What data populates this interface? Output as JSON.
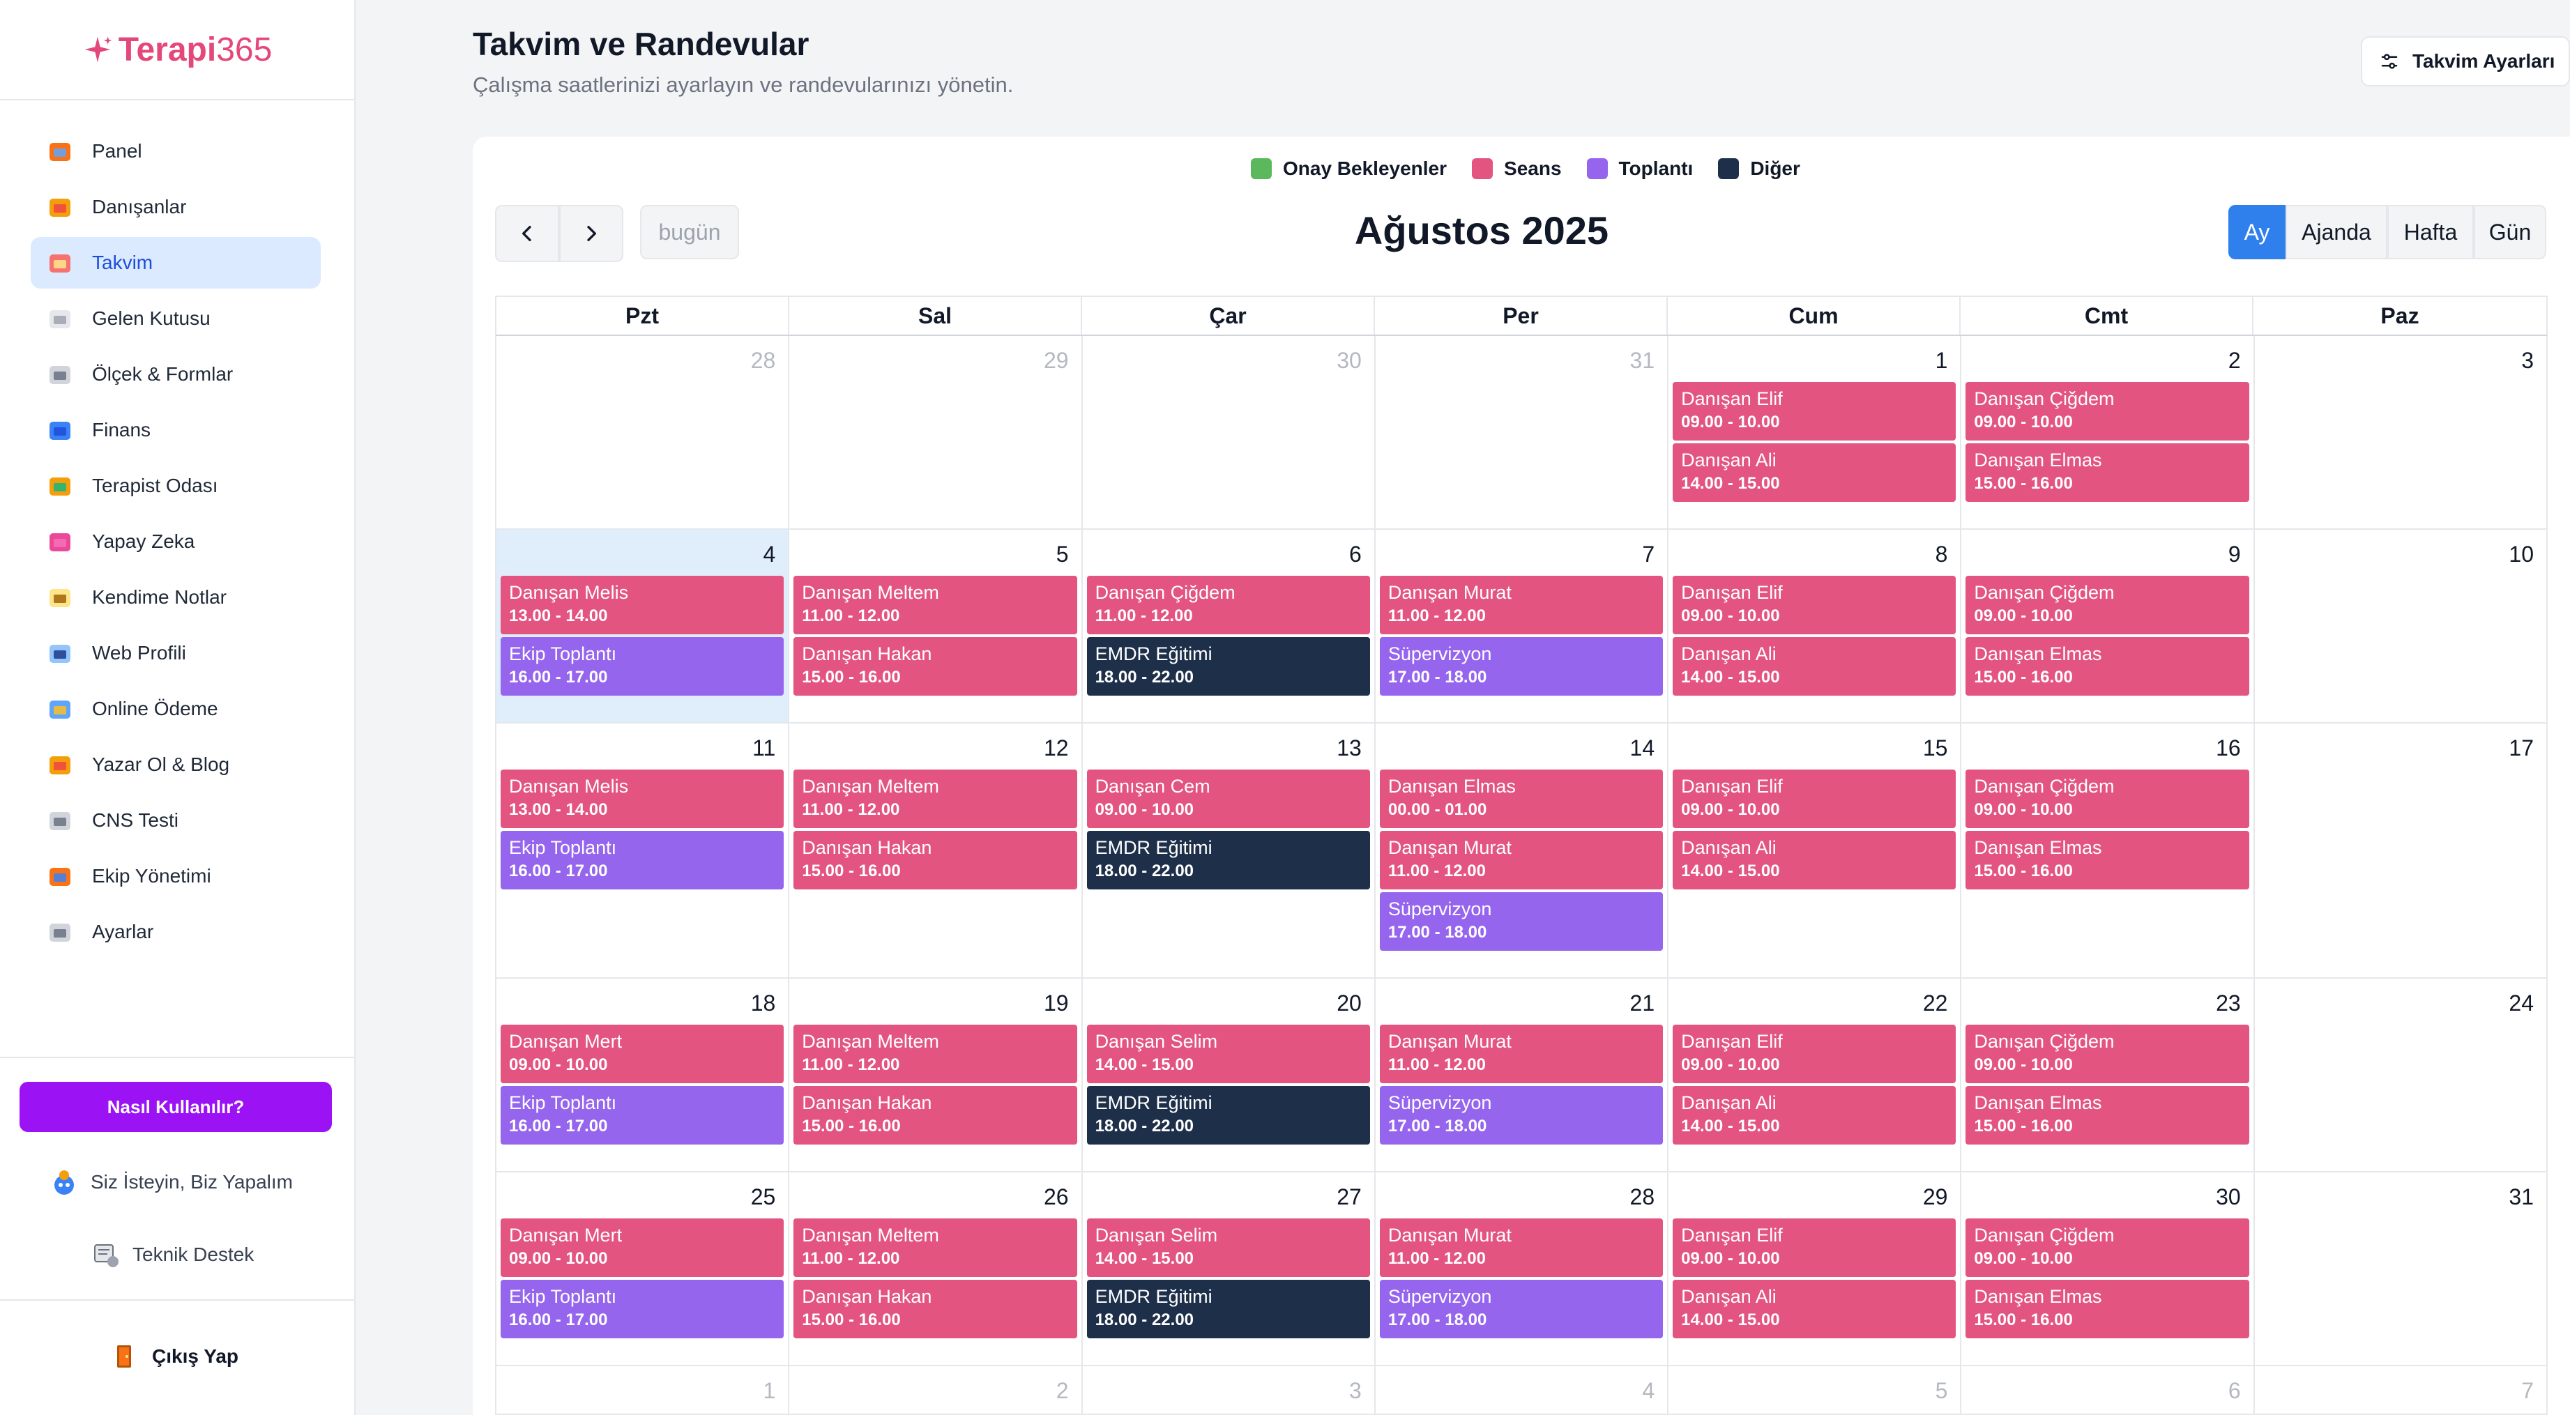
{
  "brand": {
    "name_bold": "Terapi",
    "name_light": "365",
    "color": "#e4477a"
  },
  "sidebar": {
    "items": [
      {
        "label": "Panel",
        "icon": "house-icon",
        "active": false
      },
      {
        "label": "Danışanlar",
        "icon": "people-icon",
        "active": false
      },
      {
        "label": "Takvim",
        "icon": "calendar-icon",
        "active": true
      },
      {
        "label": "Gelen Kutusu",
        "icon": "envelope-icon",
        "active": false
      },
      {
        "label": "Ölçek & Formlar",
        "icon": "forms-icon",
        "active": false
      },
      {
        "label": "Finans",
        "icon": "finance-icon",
        "active": false
      },
      {
        "label": "Terapist Odası",
        "icon": "therapist-room-icon",
        "active": false
      },
      {
        "label": "Yapay Zeka",
        "icon": "sparkle-icon",
        "active": false
      },
      {
        "label": "Kendime Notlar",
        "icon": "notes-icon",
        "active": false
      },
      {
        "label": "Web Profili",
        "icon": "web-profile-icon",
        "active": false
      },
      {
        "label": "Online Ödeme",
        "icon": "payment-icon",
        "active": false
      },
      {
        "label": "Yazar Ol & Blog",
        "icon": "writer-icon",
        "active": false
      },
      {
        "label": "CNS Testi",
        "icon": "brain-icon",
        "active": false
      },
      {
        "label": "Ekip Yönetimi",
        "icon": "team-icon",
        "active": false
      },
      {
        "label": "Ayarlar",
        "icon": "gear-icon",
        "active": false
      }
    ],
    "help_button": "Nasıl Kullanılır?",
    "request_link": "Siz İsteyin, Biz Yapalım",
    "support_link": "Teknik Destek",
    "logout": "Çıkış Yap"
  },
  "header": {
    "title": "Takvim ve Randevular",
    "subtitle": "Çalışma saatlerinizi ayarlayın ve randevularınızı yönetin.",
    "settings_button": "Takvim Ayarları"
  },
  "legend": [
    {
      "label": "Onay Bekleyenler",
      "color": "#5cb85c"
    },
    {
      "label": "Seans",
      "color": "#e35480"
    },
    {
      "label": "Toplantı",
      "color": "#9565ee"
    },
    {
      "label": "Diğer",
      "color": "#1e2f4a"
    }
  ],
  "toolbar": {
    "prev_icon": "chevron-left-icon",
    "next_icon": "chevron-right-icon",
    "today": "bugün",
    "month_title": "Ağustos 2025",
    "views": [
      {
        "label": "Ay",
        "active": true
      },
      {
        "label": "Ajanda",
        "active": false
      },
      {
        "label": "Hafta",
        "active": false
      },
      {
        "label": "Gün",
        "active": false
      }
    ]
  },
  "calendar": {
    "weekdays": [
      "Pzt",
      "Sal",
      "Çar",
      "Per",
      "Cum",
      "Cmt",
      "Paz"
    ],
    "weeks": [
      {
        "days": [
          {
            "num": "28",
            "out": true,
            "events": []
          },
          {
            "num": "29",
            "out": true,
            "events": []
          },
          {
            "num": "30",
            "out": true,
            "events": []
          },
          {
            "num": "31",
            "out": true,
            "events": []
          },
          {
            "num": "1",
            "events": [
              {
                "title": "Danışan Elif",
                "time": "09.00 - 10.00",
                "type": "seans"
              },
              {
                "title": "Danışan Ali",
                "time": "14.00 - 15.00",
                "type": "seans"
              }
            ]
          },
          {
            "num": "2",
            "events": [
              {
                "title": "Danışan Çiğdem",
                "time": "09.00 - 10.00",
                "type": "seans"
              },
              {
                "title": "Danışan Elmas",
                "time": "15.00 - 16.00",
                "type": "seans"
              }
            ]
          },
          {
            "num": "3",
            "events": []
          }
        ]
      },
      {
        "days": [
          {
            "num": "4",
            "today": true,
            "events": [
              {
                "title": "Danışan Melis",
                "time": "13.00 - 14.00",
                "type": "seans"
              },
              {
                "title": "Ekip Toplantı",
                "time": "16.00 - 17.00",
                "type": "toplanti"
              }
            ]
          },
          {
            "num": "5",
            "events": [
              {
                "title": "Danışan Meltem",
                "time": "11.00 - 12.00",
                "type": "seans"
              },
              {
                "title": "Danışan Hakan",
                "time": "15.00 - 16.00",
                "type": "seans"
              }
            ]
          },
          {
            "num": "6",
            "events": [
              {
                "title": "Danışan Çiğdem",
                "time": "11.00 - 12.00",
                "type": "seans"
              },
              {
                "title": "EMDR Eğitimi",
                "time": "18.00 - 22.00",
                "type": "diger"
              }
            ]
          },
          {
            "num": "7",
            "events": [
              {
                "title": "Danışan Murat",
                "time": "11.00 - 12.00",
                "type": "seans"
              },
              {
                "title": "Süpervizyon",
                "time": "17.00 - 18.00",
                "type": "toplanti"
              }
            ]
          },
          {
            "num": "8",
            "events": [
              {
                "title": "Danışan Elif",
                "time": "09.00 - 10.00",
                "type": "seans"
              },
              {
                "title": "Danışan Ali",
                "time": "14.00 - 15.00",
                "type": "seans"
              }
            ]
          },
          {
            "num": "9",
            "events": [
              {
                "title": "Danışan Çiğdem",
                "time": "09.00 - 10.00",
                "type": "seans"
              },
              {
                "title": "Danışan Elmas",
                "time": "15.00 - 16.00",
                "type": "seans"
              }
            ]
          },
          {
            "num": "10",
            "events": []
          }
        ]
      },
      {
        "days": [
          {
            "num": "11",
            "events": [
              {
                "title": "Danışan Melis",
                "time": "13.00 - 14.00",
                "type": "seans"
              },
              {
                "title": "Ekip Toplantı",
                "time": "16.00 - 17.00",
                "type": "toplanti"
              }
            ]
          },
          {
            "num": "12",
            "events": [
              {
                "title": "Danışan Meltem",
                "time": "11.00 - 12.00",
                "type": "seans"
              },
              {
                "title": "Danışan Hakan",
                "time": "15.00 - 16.00",
                "type": "seans"
              }
            ]
          },
          {
            "num": "13",
            "events": [
              {
                "title": "Danışan Cem",
                "time": "09.00 - 10.00",
                "type": "seans"
              },
              {
                "title": "EMDR Eğitimi",
                "time": "18.00 - 22.00",
                "type": "diger"
              }
            ]
          },
          {
            "num": "14",
            "events": [
              {
                "title": "Danışan Elmas",
                "time": "00.00 - 01.00",
                "type": "seans"
              },
              {
                "title": "Danışan Murat",
                "time": "11.00 - 12.00",
                "type": "seans"
              },
              {
                "title": "Süpervizyon",
                "time": "17.00 - 18.00",
                "type": "toplanti"
              }
            ]
          },
          {
            "num": "15",
            "events": [
              {
                "title": "Danışan Elif",
                "time": "09.00 - 10.00",
                "type": "seans"
              },
              {
                "title": "Danışan Ali",
                "time": "14.00 - 15.00",
                "type": "seans"
              }
            ]
          },
          {
            "num": "16",
            "events": [
              {
                "title": "Danışan Çiğdem",
                "time": "09.00 - 10.00",
                "type": "seans"
              },
              {
                "title": "Danışan Elmas",
                "time": "15.00 - 16.00",
                "type": "seans"
              }
            ]
          },
          {
            "num": "17",
            "events": []
          }
        ]
      },
      {
        "days": [
          {
            "num": "18",
            "events": [
              {
                "title": "Danışan Mert",
                "time": "09.00 - 10.00",
                "type": "seans"
              },
              {
                "title": "Ekip Toplantı",
                "time": "16.00 - 17.00",
                "type": "toplanti"
              }
            ]
          },
          {
            "num": "19",
            "events": [
              {
                "title": "Danışan Meltem",
                "time": "11.00 - 12.00",
                "type": "seans"
              },
              {
                "title": "Danışan Hakan",
                "time": "15.00 - 16.00",
                "type": "seans"
              }
            ]
          },
          {
            "num": "20",
            "events": [
              {
                "title": "Danışan Selim",
                "time": "14.00 - 15.00",
                "type": "seans"
              },
              {
                "title": "EMDR Eğitimi",
                "time": "18.00 - 22.00",
                "type": "diger"
              }
            ]
          },
          {
            "num": "21",
            "events": [
              {
                "title": "Danışan Murat",
                "time": "11.00 - 12.00",
                "type": "seans"
              },
              {
                "title": "Süpervizyon",
                "time": "17.00 - 18.00",
                "type": "toplanti"
              }
            ]
          },
          {
            "num": "22",
            "events": [
              {
                "title": "Danışan Elif",
                "time": "09.00 - 10.00",
                "type": "seans"
              },
              {
                "title": "Danışan Ali",
                "time": "14.00 - 15.00",
                "type": "seans"
              }
            ]
          },
          {
            "num": "23",
            "events": [
              {
                "title": "Danışan Çiğdem",
                "time": "09.00 - 10.00",
                "type": "seans"
              },
              {
                "title": "Danışan Elmas",
                "time": "15.00 - 16.00",
                "type": "seans"
              }
            ]
          },
          {
            "num": "24",
            "events": []
          }
        ]
      },
      {
        "days": [
          {
            "num": "25",
            "events": [
              {
                "title": "Danışan Mert",
                "time": "09.00 - 10.00",
                "type": "seans"
              },
              {
                "title": "Ekip Toplantı",
                "time": "16.00 - 17.00",
                "type": "toplanti"
              }
            ]
          },
          {
            "num": "26",
            "events": [
              {
                "title": "Danışan Meltem",
                "time": "11.00 - 12.00",
                "type": "seans"
              },
              {
                "title": "Danışan Hakan",
                "time": "15.00 - 16.00",
                "type": "seans"
              }
            ]
          },
          {
            "num": "27",
            "events": [
              {
                "title": "Danışan Selim",
                "time": "14.00 - 15.00",
                "type": "seans"
              },
              {
                "title": "EMDR Eğitimi",
                "time": "18.00 - 22.00",
                "type": "diger"
              }
            ]
          },
          {
            "num": "28",
            "events": [
              {
                "title": "Danışan Murat",
                "time": "11.00 - 12.00",
                "type": "seans"
              },
              {
                "title": "Süpervizyon",
                "time": "17.00 - 18.00",
                "type": "toplanti"
              }
            ]
          },
          {
            "num": "29",
            "events": [
              {
                "title": "Danışan Elif",
                "time": "09.00 - 10.00",
                "type": "seans"
              },
              {
                "title": "Danışan Ali",
                "time": "14.00 - 15.00",
                "type": "seans"
              }
            ]
          },
          {
            "num": "30",
            "events": [
              {
                "title": "Danışan Çiğdem",
                "time": "09.00 - 10.00",
                "type": "seans"
              },
              {
                "title": "Danışan Elmas",
                "time": "15.00 - 16.00",
                "type": "seans"
              }
            ]
          },
          {
            "num": "31",
            "events": []
          }
        ]
      },
      {
        "days": [
          {
            "num": "1",
            "out": true,
            "events": []
          },
          {
            "num": "2",
            "out": true,
            "events": []
          },
          {
            "num": "3",
            "out": true,
            "events": []
          },
          {
            "num": "4",
            "out": true,
            "events": []
          },
          {
            "num": "5",
            "out": true,
            "events": []
          },
          {
            "num": "6",
            "out": true,
            "events": []
          },
          {
            "num": "7",
            "out": true,
            "events": []
          }
        ]
      }
    ]
  }
}
